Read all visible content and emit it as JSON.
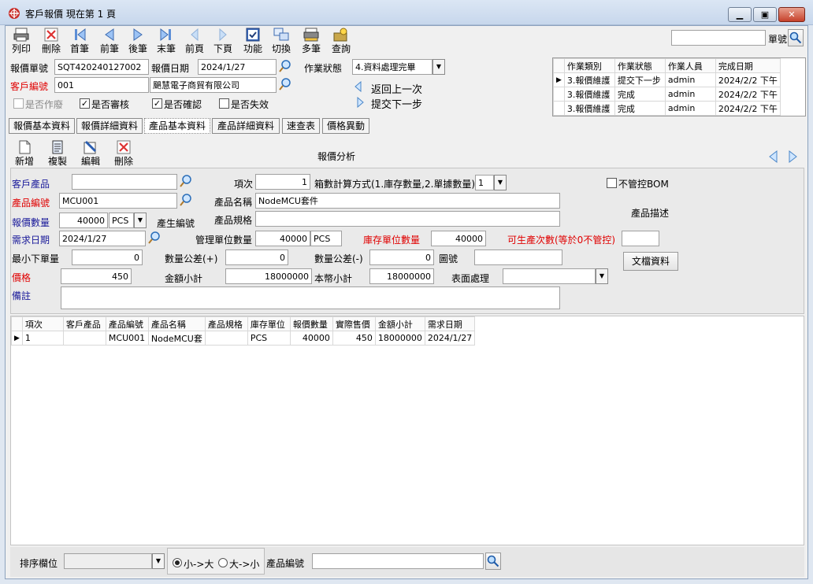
{
  "window": {
    "title": "客戶報價  現在第 1 頁",
    "minimize_icon": "minimize-icon",
    "maximize_icon": "maximize-icon",
    "close_icon": "close-icon"
  },
  "toolbar": [
    {
      "label": "列印",
      "icon": "printer-icon"
    },
    {
      "label": "刪除",
      "icon": "delete-icon"
    },
    {
      "label": "首筆",
      "icon": "first-record-icon"
    },
    {
      "label": "前筆",
      "icon": "previous-record-icon"
    },
    {
      "label": "後筆",
      "icon": "next-record-icon"
    },
    {
      "label": "末筆",
      "icon": "last-record-icon"
    },
    {
      "label": "前頁",
      "icon": "previous-page-icon"
    },
    {
      "label": "下頁",
      "icon": "next-page-icon"
    },
    {
      "label": "功能",
      "icon": "function-icon"
    },
    {
      "label": "切換",
      "icon": "switch-icon"
    },
    {
      "label": "多筆",
      "icon": "multi-record-icon"
    },
    {
      "label": "查詢",
      "icon": "query-icon"
    }
  ],
  "search": {
    "value": "",
    "label": "單號"
  },
  "header": {
    "quote_no_label": "報價單號",
    "quote_no": "SQT420240127002",
    "quote_date_label": "報價日期",
    "quote_date": "2024/1/27",
    "status_label": "作業狀態",
    "status": "4.資料處理完畢",
    "customer_label": "客戶編號",
    "customer_code": "001",
    "customer_name": "颶慧電子商貿有限公司",
    "back_label": "返回上一次",
    "submit_label": "提交下一步",
    "void_label": "是否作廢",
    "reviewed_label": "是否審核",
    "confirmed_label": "是否確認",
    "invalid_label": "是否失效"
  },
  "workflow": {
    "columns": [
      "作業類別",
      "作業狀態",
      "作業人員",
      "完成日期"
    ],
    "rows": [
      [
        "3.報價維護",
        "提交下一步",
        "admin",
        "2024/2/2 下午"
      ],
      [
        "3.報價維護",
        "完成",
        "admin",
        "2024/2/2 下午"
      ],
      [
        "3.報價維護",
        "完成",
        "admin",
        "2024/2/2 下午"
      ]
    ]
  },
  "tabs": [
    "報價基本資料",
    "報價詳細資料",
    "產品基本資料",
    "產品詳細資料",
    "速查表",
    "價格異動"
  ],
  "subtoolbar": [
    {
      "label": "新增",
      "icon": "new-icon"
    },
    {
      "label": "複製",
      "icon": "copy-icon"
    },
    {
      "label": "編輯",
      "icon": "edit-icon"
    },
    {
      "label": "刪除",
      "icon": "delete-icon"
    }
  ],
  "section_title": "報價分析",
  "form": {
    "cust_product_label": "客戶產品",
    "cust_product": "",
    "item_no_label": "項次",
    "item_no": "1",
    "box_calc_label": "箱數計算方式(1.庫存數量,2.單據數量)",
    "box_calc": "1",
    "no_bom_label": "不管控BOM",
    "product_code_label": "產品編號",
    "product_code": "MCU001",
    "product_name_label": "產品名稱",
    "product_name": "NodeMCU套件",
    "quote_qty_label": "報價數量",
    "quote_qty": "40000",
    "quote_unit": "PCS",
    "gen_code_label": "產生編號",
    "spec_label": "產品規格",
    "spec": "",
    "desc_label": "產品描述",
    "req_date_label": "需求日期",
    "req_date": "2024/1/27",
    "mgmt_qty_label": "管理單位數量",
    "mgmt_qty": "40000",
    "mgmt_unit": "PCS",
    "stock_qty_label": "庫存單位數量",
    "stock_qty": "40000",
    "producible_label": "可生產次數(等於0不管控)",
    "producible": "",
    "min_order_label": "最小下單量",
    "min_order": "0",
    "tol_plus_label": "數量公差(+)",
    "tol_plus": "0",
    "tol_minus_label": "數量公差(-)",
    "tol_minus": "0",
    "drawing_label": "圖號",
    "drawing": "",
    "doc_button": "文檔資料",
    "price_label": "價格",
    "price": "450",
    "amount_label": "金額小計",
    "amount": "18000000",
    "local_amount_label": "本幣小計",
    "local_amount": "18000000",
    "surface_label": "表面處理",
    "surface": "",
    "note_label": "備註",
    "note": ""
  },
  "grid": {
    "columns": [
      "項次",
      "客戶產品",
      "產品編號",
      "產品名稱",
      "產品規格",
      "庫存單位",
      "報價數量",
      "實際售價",
      "金額小計",
      "需求日期"
    ],
    "rows": [
      [
        "1",
        "",
        "MCU001",
        "NodeMCU套",
        "",
        "PCS",
        "40000",
        "450",
        "18000000",
        "2024/1/27"
      ]
    ]
  },
  "footer": {
    "sort_label": "排序欄位",
    "sort_value": "",
    "asc_label": "小->大",
    "desc_label": "大->小",
    "product_code_label": "產品編號",
    "product_code": ""
  },
  "colors": {
    "red_label": "#e00000",
    "blue_label": "#1a1a9a",
    "panel": "#f0f0f0"
  }
}
